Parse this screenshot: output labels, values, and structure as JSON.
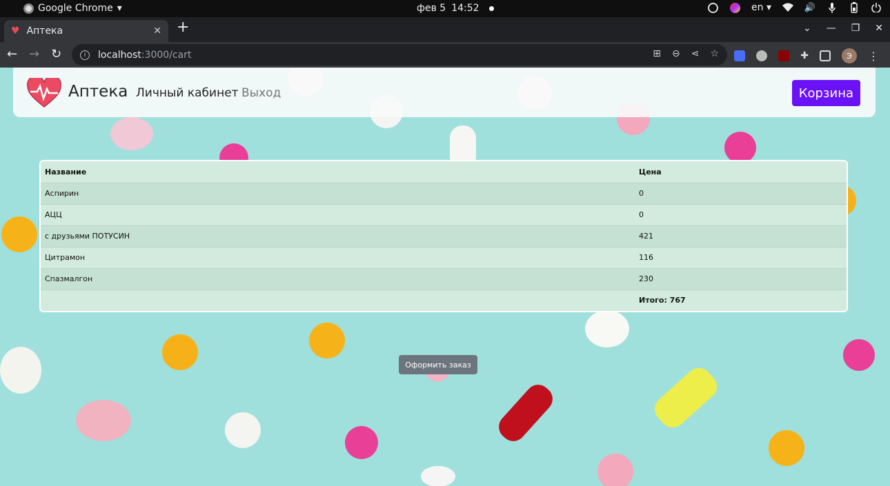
{
  "system_bar": {
    "app_name": "Google Chrome",
    "date": "фев 5",
    "time": "14:52",
    "language": "en"
  },
  "browser": {
    "tab_title": "Аптека",
    "url_host": "localhost",
    "url_path": ":3000/cart",
    "profile_initial": "Э"
  },
  "navbar": {
    "brand": "Аптека",
    "links": [
      "Личный кабинет",
      "Выход"
    ],
    "cart_button": "Корзина"
  },
  "cart_table": {
    "headers": [
      "Название",
      "Цена"
    ],
    "rows": [
      {
        "name": "Аспирин",
        "price": "0"
      },
      {
        "name": "АЦЦ",
        "price": "0"
      },
      {
        "name": "с друзьями ПОТУСИН",
        "price": "421"
      },
      {
        "name": "Цитрамон",
        "price": "116"
      },
      {
        "name": "Спазмалгон",
        "price": "230"
      }
    ],
    "total_label": "Итого: 767"
  },
  "order_button": "Оформить заказ",
  "colors": {
    "accent": "#6a12f5",
    "background": "#9fe0dc",
    "order_button": "#6c757d",
    "table_bg": "#cfe9dc"
  }
}
